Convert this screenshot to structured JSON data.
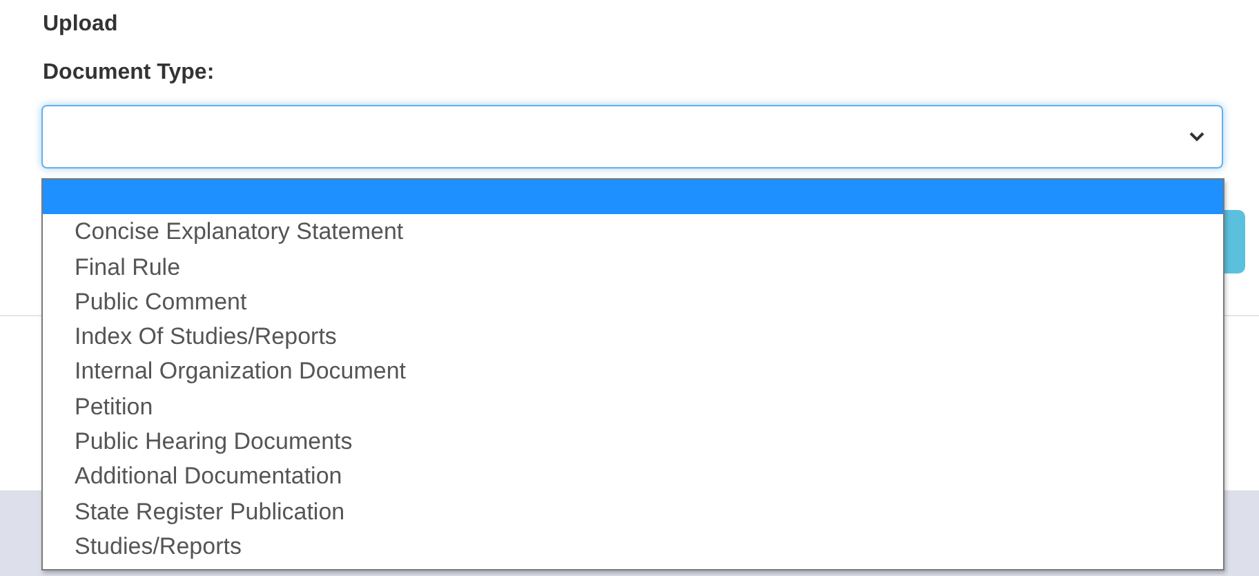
{
  "heading": "Upload",
  "field": {
    "label": "Document Type:",
    "expanded": true
  },
  "options": [
    {
      "selected": true
    },
    {
      "label": "Concise Explanatory Statement",
      "selected": false
    },
    {
      "label": "Final Rule",
      "selected": false
    },
    {
      "label": "Public Comment",
      "selected": false
    },
    {
      "label": "Index Of Studies/Reports",
      "selected": false
    },
    {
      "label": "Internal Organization Document",
      "selected": false
    },
    {
      "label": "Petition",
      "selected": false
    },
    {
      "label": "Public Hearing Documents",
      "selected": false
    },
    {
      "label": "Additional Documentation",
      "selected": false
    },
    {
      "label": "State Register Publication",
      "selected": false
    },
    {
      "label": "Studies/Reports",
      "selected": false
    }
  ]
}
